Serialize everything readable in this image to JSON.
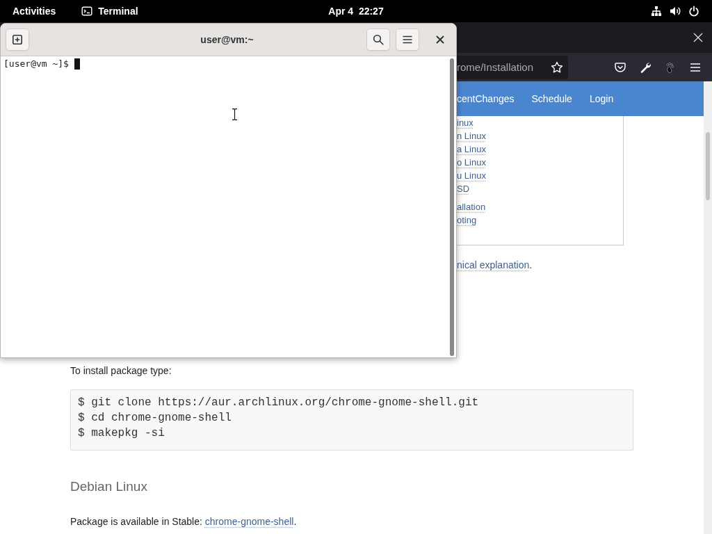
{
  "top_bar": {
    "activities": "Activities",
    "app_name": "Terminal",
    "clock": "Apr 4  22:27"
  },
  "browser": {
    "url_fragment": "rome/Installation",
    "nav_links": [
      "centChanges",
      "Schedule",
      "Login"
    ],
    "toc_groups": [
      {
        "items": [
          "inux",
          "n Linux",
          "a Linux",
          "o Linux",
          "u Linux",
          "SD"
        ]
      },
      {
        "items": [
          "allation",
          "oting"
        ]
      }
    ],
    "explanation": {
      "link": "nical explanation",
      "after": "."
    },
    "install_prompt": "To install package type:",
    "code_lines": [
      "$ git clone https://aur.archlinux.org/chrome-gnome-shell.git",
      "$ cd chrome-gnome-shell",
      "$ makepkg -si"
    ],
    "section_heading": "Debian Linux",
    "package_note": {
      "text": "Package is available in Stable:",
      "link": "chrome-gnome-shell",
      "after": "."
    }
  },
  "terminal": {
    "title": "user@vm:~",
    "prompt": "[user@vm ~]$"
  }
}
